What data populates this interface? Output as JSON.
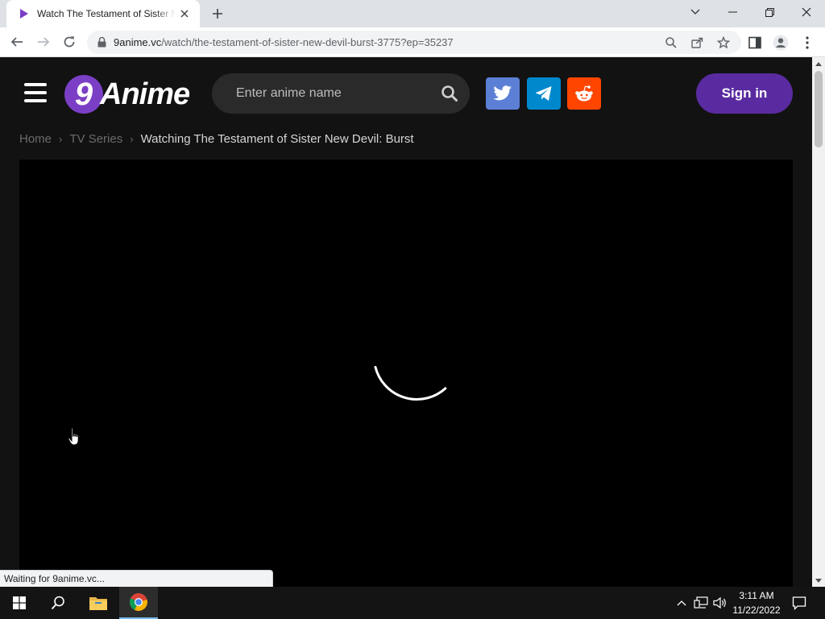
{
  "browser": {
    "tab_title": "Watch The Testament of Sister New Devil: Burst",
    "url_host": "9anime.vc",
    "url_path": "/watch/the-testament-of-sister-new-devil-burst-3775?ep=35237",
    "status_text": "Waiting for 9anime.vc..."
  },
  "site": {
    "logo_badge": "9",
    "logo_text": "Anime",
    "search_placeholder": "Enter anime name",
    "signin_label": "Sign in",
    "social": [
      {
        "name": "twitter",
        "color": "#5c7fd6"
      },
      {
        "name": "telegram",
        "color": "#0088cc"
      },
      {
        "name": "reddit",
        "color": "#ff4500"
      }
    ],
    "accent": "#5a2ba0"
  },
  "breadcrumb": {
    "home": "Home",
    "series": "TV Series",
    "current": "Watching The Testament of Sister New Devil: Burst"
  },
  "taskbar": {
    "time": "3:11 AM",
    "date": "11/22/2022"
  }
}
